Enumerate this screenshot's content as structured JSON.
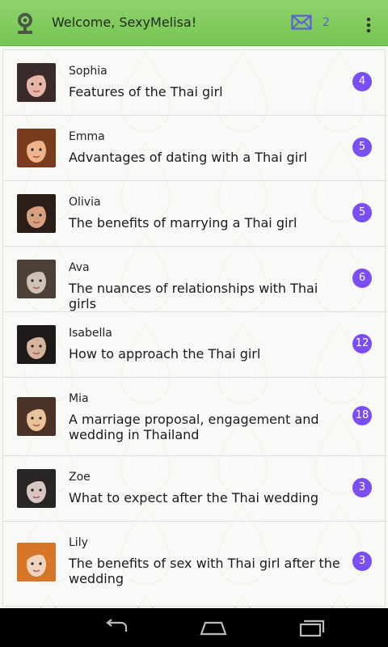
{
  "header": {
    "title": "Welcome, SexyMelisa!",
    "mail_count": "2",
    "icons": {
      "app": "webcam-icon",
      "mail": "envelope-icon",
      "menu": "overflow-menu-icon"
    }
  },
  "colors": {
    "action_bar": "#80cb5f",
    "badge": "#7a4ef0",
    "mail": "#5b5fd6"
  },
  "topics": [
    {
      "author": "Sophia",
      "title": "Features of the Thai girl",
      "count": "4"
    },
    {
      "author": "Emma",
      "title": "Advantages of dating with a Thai girl",
      "count": "5"
    },
    {
      "author": "Olivia",
      "title": "The benefits of marrying a Thai girl",
      "count": "5"
    },
    {
      "author": "Ava",
      "title": "The nuances of relationships with Thai girls",
      "count": "6"
    },
    {
      "author": "Isabella",
      "title": "How to approach the Thai girl",
      "count": "12"
    },
    {
      "author": "Mia",
      "title": "A marriage proposal, engagement and wedding in Thailand",
      "count": "18"
    },
    {
      "author": "Zoe",
      "title": "What to expect after the Thai wedding",
      "count": "3"
    },
    {
      "author": "Lily",
      "title": "The benefits of sex with Thai girl after the wedding",
      "count": "3"
    }
  ],
  "nav": {
    "icons": [
      "back-icon",
      "home-icon",
      "recent-apps-icon"
    ]
  }
}
